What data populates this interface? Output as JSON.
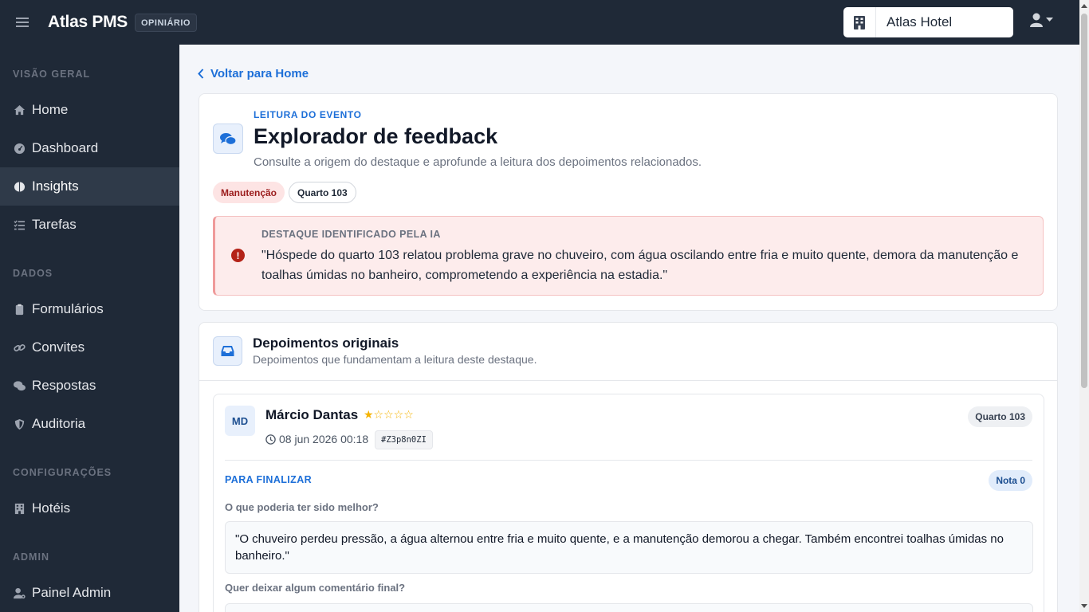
{
  "topbar": {
    "brand": "Atlas PMS",
    "badge": "OPINIÁRIO",
    "hotel": "Atlas Hotel"
  },
  "sidebar": {
    "sections": [
      "VISÃO GERAL",
      "DADOS",
      "CONFIGURAÇÕES",
      "ADMIN"
    ],
    "items": [
      {
        "label": "Home",
        "icon": "home-icon"
      },
      {
        "label": "Dashboard",
        "icon": "dashboard-icon"
      },
      {
        "label": "Insights",
        "icon": "brain-icon",
        "active": true
      },
      {
        "label": "Tarefas",
        "icon": "tasks-icon"
      },
      {
        "label": "Formulários",
        "icon": "clipboard-icon"
      },
      {
        "label": "Convites",
        "icon": "link-icon"
      },
      {
        "label": "Respostas",
        "icon": "comments-icon"
      },
      {
        "label": "Auditoria",
        "icon": "shield-icon"
      },
      {
        "label": "Hotéis",
        "icon": "building-icon"
      },
      {
        "label": "Painel Admin",
        "icon": "user-cog-icon"
      }
    ]
  },
  "main": {
    "back_link": "Voltar para Home",
    "eyebrow": "LEITURA DO EVENTO",
    "title": "Explorador de feedback",
    "subtitle": "Consulte a origem do destaque e aprofunde a leitura dos depoimentos relacionados.",
    "tags": [
      "Manutenção",
      "Quarto 103"
    ],
    "highlight": {
      "label": "DESTAQUE IDENTIFICADO PELA IA",
      "text": "\"Hóspede do quarto 103 relatou problema grave no chuveiro, com água oscilando entre fria e muito quente, demora da manutenção e toalhas úmidas no banheiro, comprometendo a experiência na estadia.\""
    },
    "testimonials": {
      "title": "Depoimentos originais",
      "subtitle": "Depoimentos que fundamentam a leitura deste destaque.",
      "review": {
        "initials": "MD",
        "name": "Márcio Dantas",
        "rating": 1,
        "max_rating": 5,
        "stars": "★☆☆☆☆",
        "date": "08 jun 2026 00:18",
        "id": "#Z3p8n0ZI",
        "room": "Quarto 103",
        "section": "PARA FINALIZAR",
        "score": "Nota 0",
        "q1": "O que poderia ter sido melhor?",
        "a1": "\"O chuveiro perdeu pressão, a água alternou entre fria e muito quente, e a manutenção demorou a chegar. Também encontrei toalhas úmidas no banheiro.\"",
        "q2": "Quer deixar algum comentário final?"
      }
    }
  },
  "colors": {
    "sidebar_bg": "#1f2937",
    "accent": "#1d6fd8",
    "alert": "#b42318",
    "star": "#f5b301"
  }
}
